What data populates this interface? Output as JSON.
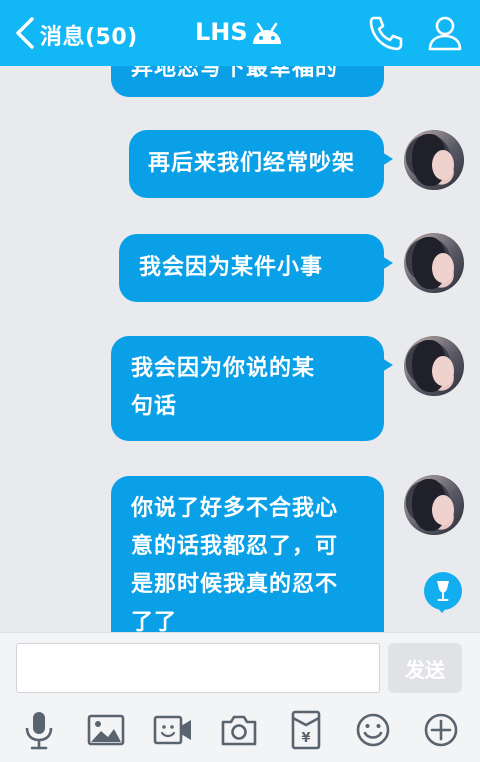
{
  "header": {
    "back_label": "消息(50)",
    "title": "LHS"
  },
  "messages": [
    {
      "line1": "异地恋写下最幸福的"
    },
    {
      "line1": "再后来我们经常吵架"
    },
    {
      "line1": "我会因为某件小事"
    },
    {
      "line1": "我会因为你说的某",
      "line2": "句话"
    },
    {
      "line1": "你说了好多不合我心",
      "line2": "意的话我都忍了，可",
      "line3": "是那时候我真的忍不",
      "line4": "了了"
    }
  ],
  "input": {
    "value": "",
    "placeholder": ""
  },
  "send_label": "发送",
  "colors": {
    "accent": "#12b7f5",
    "bubble": "#0aa0e8"
  },
  "toolbar_icons": [
    "microphone-icon",
    "image-icon",
    "video-icon",
    "camera-icon",
    "red-packet-icon",
    "emoji-icon",
    "plus-icon"
  ]
}
